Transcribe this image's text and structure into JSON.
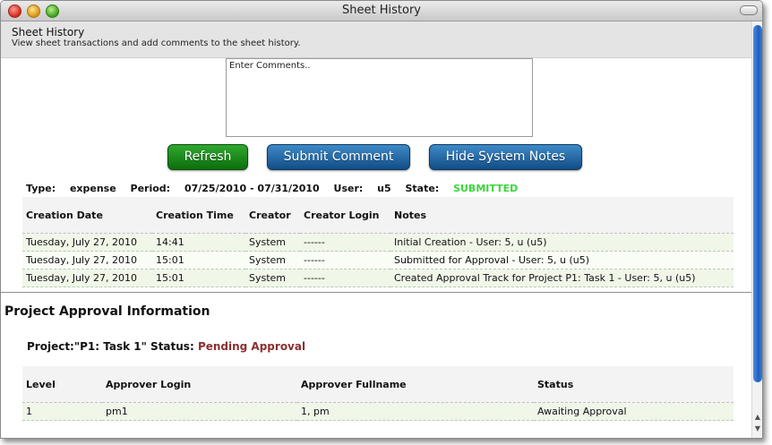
{
  "window": {
    "title": "Sheet History"
  },
  "header": {
    "title": "Sheet History",
    "subtitle": "View sheet transactions and add comments to the sheet history."
  },
  "comments": {
    "value": "Enter Comments.."
  },
  "buttons": {
    "refresh": "Refresh",
    "submit_comment": "Submit Comment",
    "hide_system_notes": "Hide System Notes"
  },
  "summary": {
    "type_label": "Type:",
    "type_value": "expense",
    "period_label": "Period:",
    "period_value": "07/25/2010 - 07/31/2010",
    "user_label": "User:",
    "user_value": "u5",
    "state_label": "State:",
    "state_value": "SUBMITTED"
  },
  "history_table": {
    "headers": [
      "Creation Date",
      "Creation Time",
      "Creator",
      "Creator Login",
      "Notes"
    ],
    "rows": [
      [
        "Tuesday, July 27, 2010",
        "14:41",
        "System",
        "------",
        "Initial Creation - User: 5, u (u5)"
      ],
      [
        "Tuesday, July 27, 2010",
        "15:01",
        "System",
        "------",
        "Submitted for Approval - User: 5, u (u5)"
      ],
      [
        "Tuesday, July 27, 2010",
        "15:01",
        "System",
        "------",
        "Created Approval Track for Project P1: Task 1 - User: 5, u (u5)"
      ]
    ]
  },
  "approval": {
    "section_title": "Project Approval Information",
    "project_label": "Project:\"P1: Task 1\" Status:",
    "project_status": "Pending Approval",
    "headers": [
      "Level",
      "Approver Login",
      "Approver Fullname",
      "Status"
    ],
    "rows": [
      [
        "1",
        "pm1",
        "1, pm",
        "Awaiting Approval"
      ]
    ]
  },
  "colors": {
    "state_submitted": "#3bd63b",
    "pending_status": "#8a3030",
    "refresh_button": "#1a8a1a",
    "blue_button": "#1d5d9b",
    "scroll_thumb": "#2f73d0"
  }
}
